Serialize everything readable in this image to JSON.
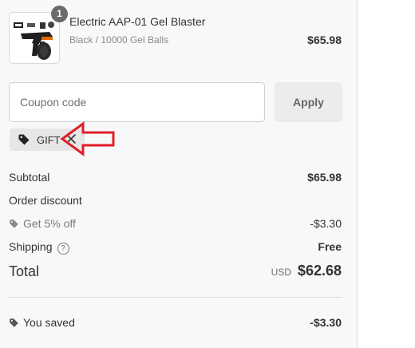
{
  "product": {
    "quantity": "1",
    "name": "Electric AAP-01 Gel Blaster",
    "variant": "Black / 10000 Gel Balls",
    "price": "$65.98",
    "image_icon": "gel-blaster-product-image"
  },
  "coupon": {
    "placeholder": "Coupon code",
    "value": "",
    "apply_label": "Apply"
  },
  "applied_code": {
    "code": "GIFT",
    "icon": "tag-icon",
    "remove_icon": "close-icon"
  },
  "summary": {
    "subtotal_label": "Subtotal",
    "subtotal_value": "$65.98",
    "order_discount_label": "Order discount",
    "discount_name": "Get 5% off",
    "discount_value": "-$3.30",
    "shipping_label": "Shipping",
    "shipping_help": "?",
    "shipping_value": "Free",
    "total_label": "Total",
    "total_currency": "USD",
    "total_value": "$62.68",
    "saved_label": "You saved",
    "saved_value": "-$3.30"
  },
  "colors": {
    "annotation_arrow": "#e0202a",
    "panel_background": "#f7f8fa"
  }
}
